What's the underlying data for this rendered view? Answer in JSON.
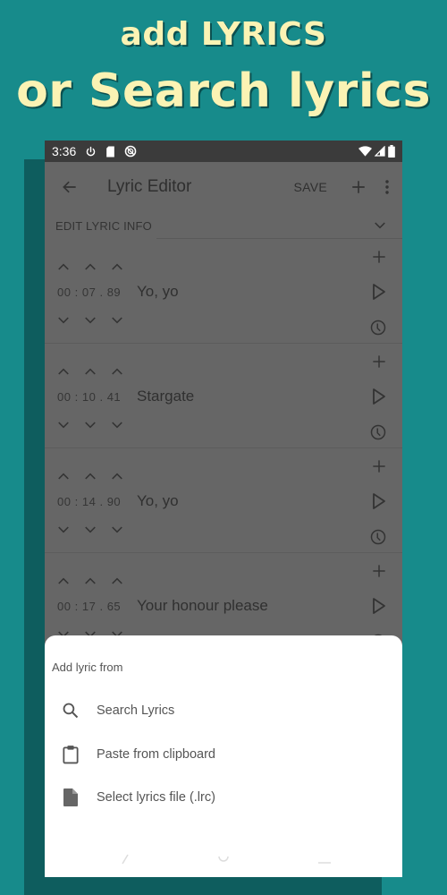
{
  "promo": {
    "line1": "add LYRICS",
    "line2": "or Search lyrics",
    "text_color": "#fbf3b4",
    "background_color": "#178b8b"
  },
  "statusbar": {
    "time": "3:36",
    "left_icons": [
      "power-icon",
      "sd-card-icon",
      "data-saver-icon"
    ],
    "right_icons": [
      "wifi-icon",
      "cell-signal-icon",
      "battery-icon"
    ]
  },
  "appbar": {
    "title": "Lyric Editor",
    "save_label": "SAVE",
    "back_icon": "arrow-left-icon",
    "add_icon": "plus-icon",
    "more_icon": "more-vertical-icon"
  },
  "edit_info": {
    "label": "EDIT LYRIC INFO",
    "icon": "chevron-down-icon"
  },
  "lyrics": [
    {
      "min": "00",
      "sec": "07",
      "cs": "89",
      "text": "Yo, yo"
    },
    {
      "min": "00",
      "sec": "10",
      "cs": "41",
      "text": "Stargate"
    },
    {
      "min": "00",
      "sec": "14",
      "cs": "90",
      "text": "Yo, yo"
    },
    {
      "min": "00",
      "sec": "17",
      "cs": "65",
      "text": "Your honour please"
    }
  ],
  "time_separators": {
    "colon": ":",
    "dot": "."
  },
  "sheet": {
    "title": "Add lyric from",
    "items": [
      {
        "label": "Search Lyrics",
        "icon": "search-icon"
      },
      {
        "label": "Paste from clipboard",
        "icon": "clipboard-icon"
      },
      {
        "label": "Select lyrics file (.lrc)",
        "icon": "file-icon"
      }
    ]
  }
}
